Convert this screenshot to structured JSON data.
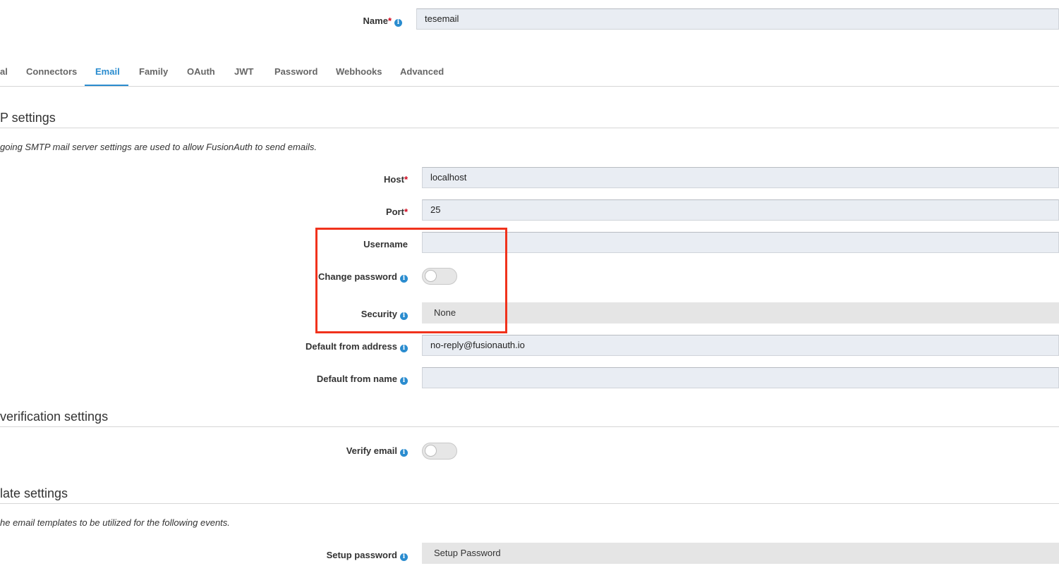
{
  "form": {
    "name_label": "Name",
    "name_required": "*",
    "name_value": "tesemail"
  },
  "tabs": [
    {
      "label": "al"
    },
    {
      "label": "Connectors"
    },
    {
      "label": "Email",
      "active": true
    },
    {
      "label": "Family"
    },
    {
      "label": "OAuth"
    },
    {
      "label": "JWT"
    },
    {
      "label": "Password"
    },
    {
      "label": "Webhooks"
    },
    {
      "label": "Advanced"
    }
  ],
  "smtp": {
    "title": "P settings",
    "description": "going SMTP mail server settings are used to allow FusionAuth to send emails.",
    "host_label": "Host",
    "host_value": "localhost",
    "port_label": "Port",
    "port_value": "25",
    "username_label": "Username",
    "username_value": "",
    "change_password_label": "Change password",
    "change_password_on": false,
    "security_label": "Security",
    "security_value": "None",
    "from_address_label": "Default from address",
    "from_address_value": "no-reply@fusionauth.io",
    "from_name_label": "Default from name",
    "from_name_value": "",
    "required_mark": "*"
  },
  "verification": {
    "title": "verification settings",
    "verify_email_label": "Verify email",
    "verify_email_on": false
  },
  "templates": {
    "title": "late settings",
    "description": "he email templates to be utilized for the following events.",
    "setup_password_label": "Setup password",
    "setup_password_value": "Setup Password"
  },
  "colors": {
    "accent": "#2a8ccf",
    "required": "#d0021b",
    "highlight": "#f0321c"
  }
}
